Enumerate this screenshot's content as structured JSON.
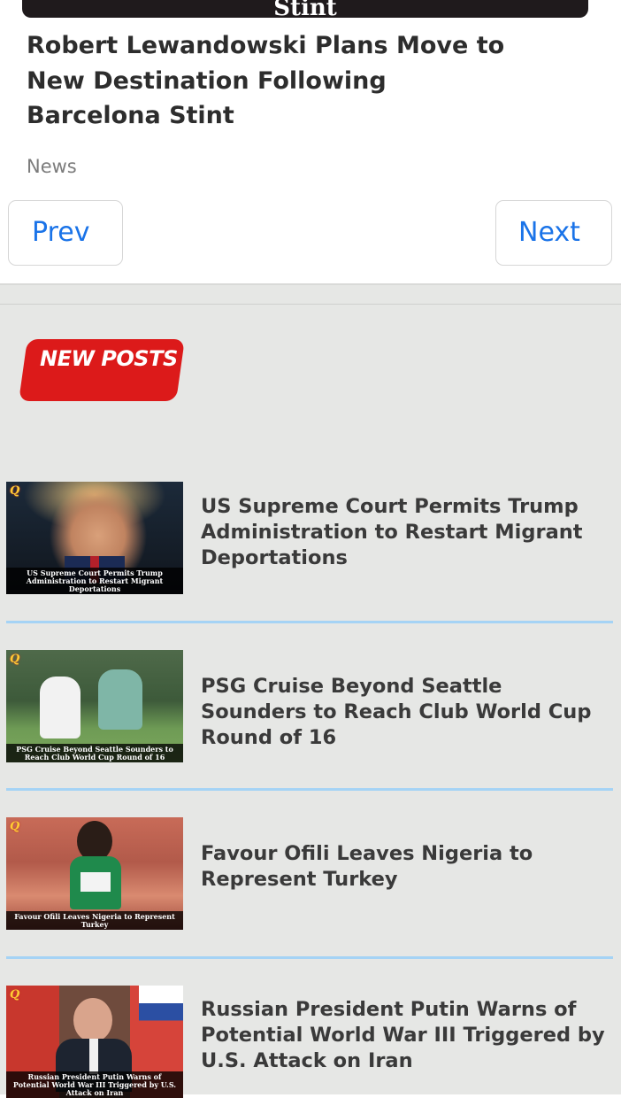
{
  "featured": {
    "image_caption": "Stint",
    "title": "Robert Lewandowski Plans Move to New Destination Following Barcelona Stint",
    "category": "News"
  },
  "pager": {
    "prev_label": "Prev",
    "next_label": "Next"
  },
  "new_posts": {
    "badge_label": "NEW POSTS",
    "items": [
      {
        "title": "US Supreme Court Permits Trump Administration to Restart Migrant Deportations",
        "thumb_caption": "US Supreme Court Permits Trump Administration to Restart Migrant Deportations"
      },
      {
        "title": "PSG Cruise Beyond Seattle Sounders to Reach Club World Cup Round of 16",
        "thumb_caption": "PSG Cruise Beyond Seattle Sounders to Reach Club World Cup Round of 16"
      },
      {
        "title": "Favour Ofili Leaves Nigeria to Represent Turkey",
        "thumb_caption": "Favour Ofili Leaves Nigeria to Represent Turkey"
      },
      {
        "title": "Russian President Putin Warns of Potential World War III Triggered by U.S. Attack on Iran",
        "thumb_caption": "Russian President Putin Warns of Potential World War III Triggered by U.S. Attack on Iran"
      }
    ]
  },
  "colors": {
    "link_blue": "#1a73e8",
    "badge_red": "#dc1a1a",
    "divider_blue": "#a5d3f5",
    "section_bg": "#e6e7e5"
  }
}
